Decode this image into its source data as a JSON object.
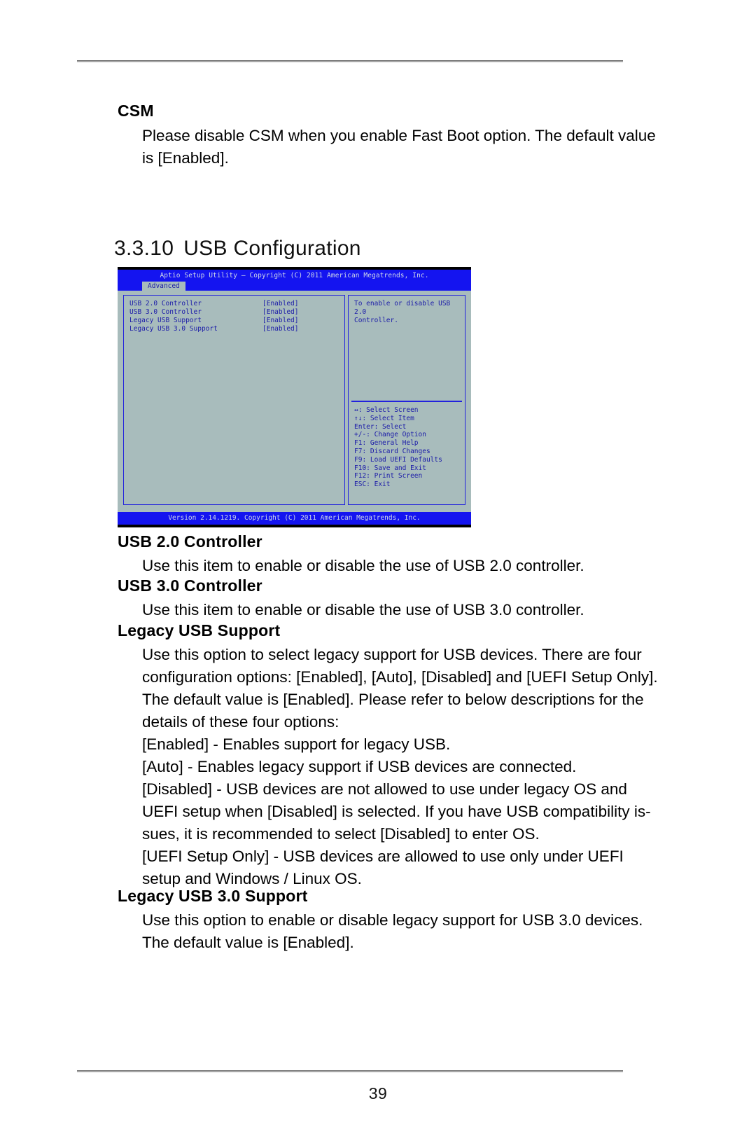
{
  "document": {
    "page_number": "39"
  },
  "csm_section": {
    "heading": "CSM",
    "lines": [
      "Please disable CSM when you enable Fast Boot option. The default value",
      "is [Enabled]."
    ]
  },
  "section": {
    "number": "3.3.10",
    "title": "USB Configuration"
  },
  "bios": {
    "titlebar": "Aptio Setup Utility – Copyright (C) 2011 American Megatrends, Inc.",
    "tab": "Advanced",
    "options": [
      {
        "name": "USB 2.0 Controller",
        "value": "[Enabled]"
      },
      {
        "name": "USB 3.0 Controller",
        "value": "[Enabled]"
      },
      {
        "name": "Legacy USB Support",
        "value": "[Enabled]"
      },
      {
        "name": "Legacy USB 3.0 Support",
        "value": "[Enabled]"
      }
    ],
    "help": [
      "To enable or disable USB 2.0",
      "Controller."
    ],
    "keys": [
      "↔: Select Screen",
      "↑↓: Select Item",
      "Enter: Select",
      "+/-: Change Option",
      "F1: General Help",
      "F7: Discard Changes",
      "F9: Load UEFI Defaults",
      "F10: Save and Exit",
      "F12: Print Screen",
      "ESC: Exit"
    ],
    "footer": "Version 2.14.1219. Copyright (C) 2011 American Megatrends, Inc."
  },
  "usb20": {
    "heading": "USB 2.0 Controller",
    "lines": [
      "Use this item to enable or disable the use of USB 2.0 controller."
    ]
  },
  "usb30": {
    "heading": "USB 3.0 Controller",
    "lines": [
      "Use this item to enable or disable the use of USB 3.0 controller."
    ]
  },
  "legacy_usb": {
    "heading": "Legacy USB Support",
    "lines": [
      "Use this option to select legacy support for USB devices. There are four",
      "configuration options: [Enabled], [Auto], [Disabled] and [UEFI Setup Only].",
      "The default value is [Enabled]. Please refer to below descriptions for the",
      "details of these four options:",
      "[Enabled] - Enables support for legacy USB.",
      "[Auto] - Enables legacy support if USB devices are connected.",
      "[Disabled] - USB devices are not allowed to use under legacy OS and",
      "UEFI setup when [Disabled] is selected. If you have USB compatibility is-",
      "sues, it is recommended to select [Disabled] to enter OS.",
      "[UEFI Setup Only] - USB devices are allowed to use only under UEFI",
      "setup and Windows / Linux OS."
    ]
  },
  "legacy_usb30": {
    "heading": "Legacy USB 3.0 Support",
    "lines": [
      "Use this option to enable or disable legacy support for USB 3.0 devices.",
      "The default value is [Enabled]."
    ]
  }
}
